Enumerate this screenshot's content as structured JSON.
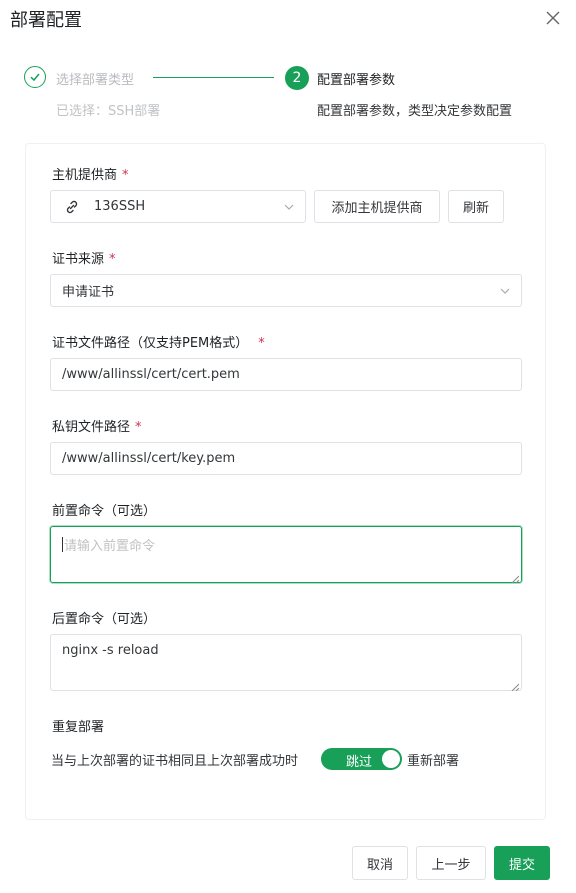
{
  "dialog": {
    "title": "部署配置"
  },
  "steps": [
    {
      "number": "1",
      "title": "选择部署类型",
      "desc": "已选择：SSH部署",
      "status": "done"
    },
    {
      "number": "2",
      "title": "配置部署参数",
      "desc": "配置部署参数，类型决定参数配置",
      "status": "active"
    }
  ],
  "form": {
    "provider": {
      "label": "主机提供商",
      "required": "*",
      "value": "136SSH",
      "icon": "link-icon",
      "add_button": "添加主机提供商",
      "refresh_button": "刷新"
    },
    "cert_source": {
      "label": "证书来源",
      "required": "*",
      "value": "申请证书"
    },
    "cert_path": {
      "label": "证书文件路径（仅支持PEM格式）",
      "required": "*",
      "value": "/www/allinssl/cert/cert.pem"
    },
    "key_path": {
      "label": "私钥文件路径",
      "required": "*",
      "value": "/www/allinssl/cert/key.pem"
    },
    "pre_cmd": {
      "label": "前置命令（可选）",
      "value": "",
      "placeholder": "请输入前置命令"
    },
    "post_cmd": {
      "label": "后置命令（可选）",
      "value": "nginx -s reload"
    },
    "redeploy": {
      "label": "重复部署",
      "sentence": "当与上次部署的证书相同且上次部署成功时",
      "toggle_on_text": "跳过",
      "toggle_after_text": "重新部署",
      "enabled": true
    }
  },
  "footer": {
    "cancel": "取消",
    "prev": "上一步",
    "submit": "提交"
  },
  "colors": {
    "primary": "#18a058",
    "required": "#d03050",
    "border": "#e0e0e6"
  }
}
